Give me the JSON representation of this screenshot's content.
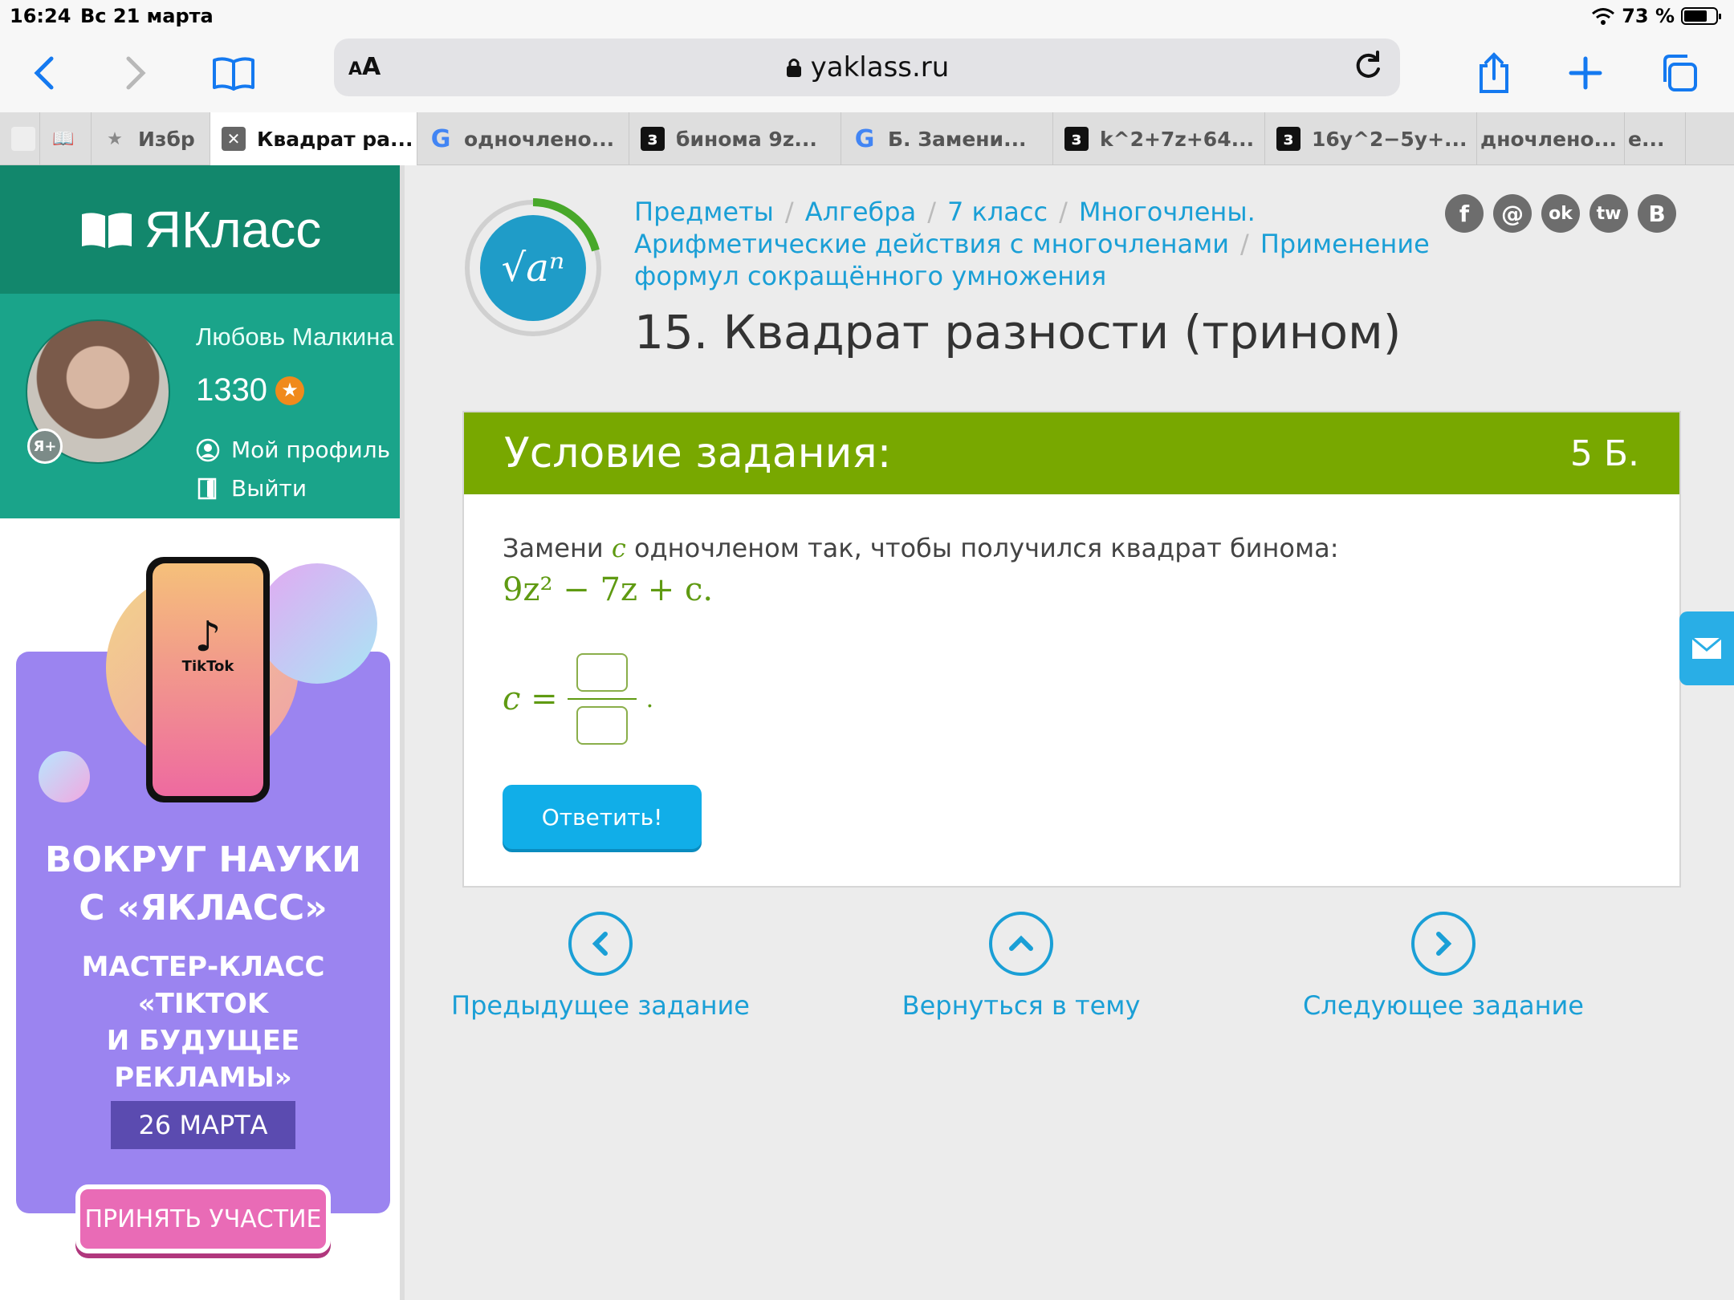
{
  "status": {
    "time": "16:24",
    "date": "Вс 21 марта",
    "battery": "73 %",
    "battery_level": 0.73
  },
  "toolbar": {
    "text_size": "AA",
    "url": "yaklass.ru"
  },
  "tabs": [
    {
      "label": "",
      "icon": "blank-icon"
    },
    {
      "label": "",
      "icon": "book-icon"
    },
    {
      "label": "Избр",
      "icon": "star-icon"
    },
    {
      "label": "Квадрат ра...",
      "icon": "close-icon"
    },
    {
      "label": "одночлено...",
      "icon": "google-icon"
    },
    {
      "label": "бинома 9z...",
      "icon": "z-icon"
    },
    {
      "label": "Б. Замени...",
      "icon": "google-icon"
    },
    {
      "label": "k^2+7z+64...",
      "icon": "z-icon"
    },
    {
      "label": "16y^2−5y+...",
      "icon": "z-icon"
    },
    {
      "label": "дночлено...",
      "icon": ""
    },
    {
      "label": "е...",
      "icon": ""
    }
  ],
  "sidebar": {
    "logo": "ЯКласс",
    "user": {
      "name": "Любовь Малкина",
      "points": "1330",
      "profile": "Мой профиль",
      "logout": "Выйти",
      "badge": "Я+"
    },
    "ad": {
      "app": "TikTok",
      "headline1": "ВОКРУГ НАУКИ",
      "headline2": "С «ЯКЛАСС»",
      "sub1": "МАСТЕР-КЛАСС",
      "sub2": "«TIKTOK",
      "sub3": "И БУДУЩЕЕ РЕКЛАМЫ»",
      "date": "26 МАРТА",
      "button": "ПРИНЯТЬ УЧАСТИЕ"
    }
  },
  "breadcrumb": {
    "items": [
      "Предметы",
      "Алгебра",
      "7 класс",
      "Многочлены. Арифметические действия с многочленами",
      "Применение формул сокращённого умножения"
    ],
    "sep": "/"
  },
  "page": {
    "title": "15. Квадрат разности (трином)",
    "emblem_text": "√aⁿ"
  },
  "social": [
    "f",
    "@",
    "ok",
    "tw",
    "В"
  ],
  "task": {
    "header": "Условие задания:",
    "points": "5 Б.",
    "text_before": "Замени ",
    "var": "c",
    "text_after": " одночленом так, чтобы получился квадрат бинома:",
    "formula": "9z² − 7z + c.",
    "answer_label": "c =",
    "answer_end": ".",
    "submit": "Ответить!"
  },
  "nav": {
    "prev": "Предыдущее задание",
    "back": "Вернуться в тему",
    "next": "Следующее задание"
  },
  "colors": {
    "accent": "#1a9fd6",
    "green": "#78a800",
    "teal": "#1aa48a",
    "button": "#11aee8"
  }
}
